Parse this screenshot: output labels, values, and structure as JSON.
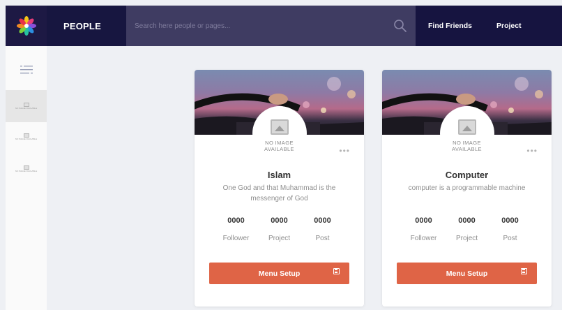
{
  "header": {
    "logo_icon": "flower-logo-icon",
    "brand": "PEOPLE",
    "search": {
      "placeholder": "Search here people or pages...",
      "icon": "search-icon"
    },
    "nav": [
      {
        "label": "Find Friends"
      },
      {
        "label": "Project"
      }
    ]
  },
  "sidebar": {
    "menu_icon": "hamburger-icon",
    "items": [
      {
        "text": "NO IMAGE AVAILABLE",
        "active": true
      },
      {
        "text": "NO IMAGE AVAILABLE",
        "active": false
      },
      {
        "text": "NO IMAGE AVAILABLE",
        "active": false
      }
    ]
  },
  "cards": [
    {
      "no_image_text": "NO IMAGE AVAILABLE",
      "more_icon": "more-dots-icon",
      "title": "Islam",
      "description": "One God and that Muhammad is the messenger of God",
      "stats": [
        {
          "value": "0000",
          "label": "Follower"
        },
        {
          "value": "0000",
          "label": "Project"
        },
        {
          "value": "0000",
          "label": "Post"
        }
      ],
      "button_label": "Menu Setup",
      "button_icon": "save-icon"
    },
    {
      "no_image_text": "NO IMAGE AVAILABLE",
      "more_icon": "more-dots-icon",
      "title": "Computer",
      "description": "computer is a programmable machine",
      "stats": [
        {
          "value": "0000",
          "label": "Follower"
        },
        {
          "value": "0000",
          "label": "Project"
        },
        {
          "value": "0000",
          "label": "Post"
        }
      ],
      "button_label": "Menu Setup",
      "button_icon": "save-icon"
    }
  ],
  "colors": {
    "header_dark": "#171640",
    "search_bg": "#3f3c62",
    "accent_button": "#df6446",
    "page_bg": "#eef0f4"
  }
}
